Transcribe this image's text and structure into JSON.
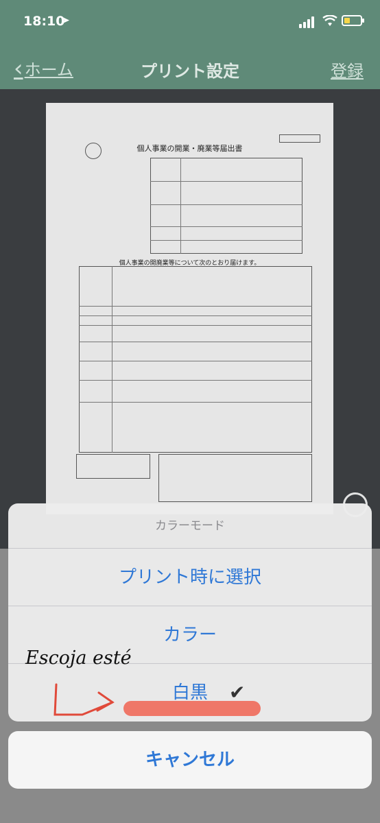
{
  "status": {
    "time": "18:10"
  },
  "nav": {
    "back_label": "ホーム",
    "title": "プリント設定",
    "register_label": "登録"
  },
  "document": {
    "title": "個人事業の開業・廃業等届出書",
    "subtitle": "個人事業の開廃業等について次のとおり届けます。"
  },
  "sheet": {
    "title": "カラーモード",
    "options": [
      "プリント時に選択",
      "カラー",
      "白黒"
    ],
    "selected_index": 2,
    "cancel_label": "キャンセル"
  },
  "annotation": {
    "text": "Escoja esté"
  },
  "colors": {
    "nav_bg": "#5f8a78",
    "action_blue": "#2f78d6",
    "highlight": "#ef6a5a"
  }
}
